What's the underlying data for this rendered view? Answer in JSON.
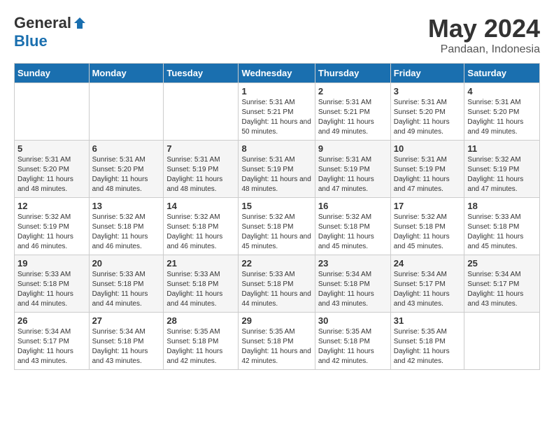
{
  "logo": {
    "general": "General",
    "blue": "Blue"
  },
  "header": {
    "month": "May 2024",
    "location": "Pandaan, Indonesia"
  },
  "weekdays": [
    "Sunday",
    "Monday",
    "Tuesday",
    "Wednesday",
    "Thursday",
    "Friday",
    "Saturday"
  ],
  "weeks": [
    [
      {
        "day": "",
        "sunrise": "",
        "sunset": "",
        "daylight": ""
      },
      {
        "day": "",
        "sunrise": "",
        "sunset": "",
        "daylight": ""
      },
      {
        "day": "",
        "sunrise": "",
        "sunset": "",
        "daylight": ""
      },
      {
        "day": "1",
        "sunrise": "Sunrise: 5:31 AM",
        "sunset": "Sunset: 5:21 PM",
        "daylight": "Daylight: 11 hours and 50 minutes."
      },
      {
        "day": "2",
        "sunrise": "Sunrise: 5:31 AM",
        "sunset": "Sunset: 5:21 PM",
        "daylight": "Daylight: 11 hours and 49 minutes."
      },
      {
        "day": "3",
        "sunrise": "Sunrise: 5:31 AM",
        "sunset": "Sunset: 5:20 PM",
        "daylight": "Daylight: 11 hours and 49 minutes."
      },
      {
        "day": "4",
        "sunrise": "Sunrise: 5:31 AM",
        "sunset": "Sunset: 5:20 PM",
        "daylight": "Daylight: 11 hours and 49 minutes."
      }
    ],
    [
      {
        "day": "5",
        "sunrise": "Sunrise: 5:31 AM",
        "sunset": "Sunset: 5:20 PM",
        "daylight": "Daylight: 11 hours and 48 minutes."
      },
      {
        "day": "6",
        "sunrise": "Sunrise: 5:31 AM",
        "sunset": "Sunset: 5:20 PM",
        "daylight": "Daylight: 11 hours and 48 minutes."
      },
      {
        "day": "7",
        "sunrise": "Sunrise: 5:31 AM",
        "sunset": "Sunset: 5:19 PM",
        "daylight": "Daylight: 11 hours and 48 minutes."
      },
      {
        "day": "8",
        "sunrise": "Sunrise: 5:31 AM",
        "sunset": "Sunset: 5:19 PM",
        "daylight": "Daylight: 11 hours and 48 minutes."
      },
      {
        "day": "9",
        "sunrise": "Sunrise: 5:31 AM",
        "sunset": "Sunset: 5:19 PM",
        "daylight": "Daylight: 11 hours and 47 minutes."
      },
      {
        "day": "10",
        "sunrise": "Sunrise: 5:31 AM",
        "sunset": "Sunset: 5:19 PM",
        "daylight": "Daylight: 11 hours and 47 minutes."
      },
      {
        "day": "11",
        "sunrise": "Sunrise: 5:32 AM",
        "sunset": "Sunset: 5:19 PM",
        "daylight": "Daylight: 11 hours and 47 minutes."
      }
    ],
    [
      {
        "day": "12",
        "sunrise": "Sunrise: 5:32 AM",
        "sunset": "Sunset: 5:19 PM",
        "daylight": "Daylight: 11 hours and 46 minutes."
      },
      {
        "day": "13",
        "sunrise": "Sunrise: 5:32 AM",
        "sunset": "Sunset: 5:18 PM",
        "daylight": "Daylight: 11 hours and 46 minutes."
      },
      {
        "day": "14",
        "sunrise": "Sunrise: 5:32 AM",
        "sunset": "Sunset: 5:18 PM",
        "daylight": "Daylight: 11 hours and 46 minutes."
      },
      {
        "day": "15",
        "sunrise": "Sunrise: 5:32 AM",
        "sunset": "Sunset: 5:18 PM",
        "daylight": "Daylight: 11 hours and 45 minutes."
      },
      {
        "day": "16",
        "sunrise": "Sunrise: 5:32 AM",
        "sunset": "Sunset: 5:18 PM",
        "daylight": "Daylight: 11 hours and 45 minutes."
      },
      {
        "day": "17",
        "sunrise": "Sunrise: 5:32 AM",
        "sunset": "Sunset: 5:18 PM",
        "daylight": "Daylight: 11 hours and 45 minutes."
      },
      {
        "day": "18",
        "sunrise": "Sunrise: 5:33 AM",
        "sunset": "Sunset: 5:18 PM",
        "daylight": "Daylight: 11 hours and 45 minutes."
      }
    ],
    [
      {
        "day": "19",
        "sunrise": "Sunrise: 5:33 AM",
        "sunset": "Sunset: 5:18 PM",
        "daylight": "Daylight: 11 hours and 44 minutes."
      },
      {
        "day": "20",
        "sunrise": "Sunrise: 5:33 AM",
        "sunset": "Sunset: 5:18 PM",
        "daylight": "Daylight: 11 hours and 44 minutes."
      },
      {
        "day": "21",
        "sunrise": "Sunrise: 5:33 AM",
        "sunset": "Sunset: 5:18 PM",
        "daylight": "Daylight: 11 hours and 44 minutes."
      },
      {
        "day": "22",
        "sunrise": "Sunrise: 5:33 AM",
        "sunset": "Sunset: 5:18 PM",
        "daylight": "Daylight: 11 hours and 44 minutes."
      },
      {
        "day": "23",
        "sunrise": "Sunrise: 5:34 AM",
        "sunset": "Sunset: 5:18 PM",
        "daylight": "Daylight: 11 hours and 43 minutes."
      },
      {
        "day": "24",
        "sunrise": "Sunrise: 5:34 AM",
        "sunset": "Sunset: 5:17 PM",
        "daylight": "Daylight: 11 hours and 43 minutes."
      },
      {
        "day": "25",
        "sunrise": "Sunrise: 5:34 AM",
        "sunset": "Sunset: 5:17 PM",
        "daylight": "Daylight: 11 hours and 43 minutes."
      }
    ],
    [
      {
        "day": "26",
        "sunrise": "Sunrise: 5:34 AM",
        "sunset": "Sunset: 5:17 PM",
        "daylight": "Daylight: 11 hours and 43 minutes."
      },
      {
        "day": "27",
        "sunrise": "Sunrise: 5:34 AM",
        "sunset": "Sunset: 5:18 PM",
        "daylight": "Daylight: 11 hours and 43 minutes."
      },
      {
        "day": "28",
        "sunrise": "Sunrise: 5:35 AM",
        "sunset": "Sunset: 5:18 PM",
        "daylight": "Daylight: 11 hours and 42 minutes."
      },
      {
        "day": "29",
        "sunrise": "Sunrise: 5:35 AM",
        "sunset": "Sunset: 5:18 PM",
        "daylight": "Daylight: 11 hours and 42 minutes."
      },
      {
        "day": "30",
        "sunrise": "Sunrise: 5:35 AM",
        "sunset": "Sunset: 5:18 PM",
        "daylight": "Daylight: 11 hours and 42 minutes."
      },
      {
        "day": "31",
        "sunrise": "Sunrise: 5:35 AM",
        "sunset": "Sunset: 5:18 PM",
        "daylight": "Daylight: 11 hours and 42 minutes."
      },
      {
        "day": "",
        "sunrise": "",
        "sunset": "",
        "daylight": ""
      }
    ]
  ]
}
